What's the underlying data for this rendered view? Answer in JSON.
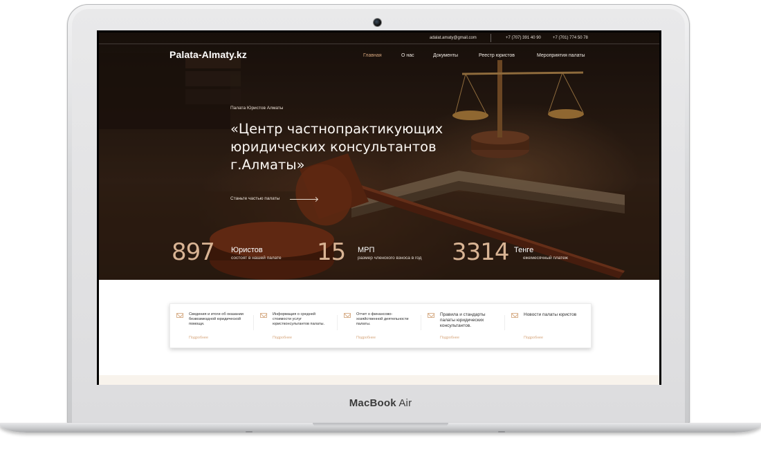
{
  "device": {
    "brand_bold": "MacBook",
    "brand_light": "Air"
  },
  "topbar": {
    "email": "adalat.amaty@gmail.com",
    "phone1": "+7 (707) 391 40 90",
    "phone2": "+7 (701) 774 50 78"
  },
  "header": {
    "logo": "Palata-Almaty.kz",
    "nav": [
      {
        "label": "Главная",
        "active": true
      },
      {
        "label": "О нас",
        "active": false
      },
      {
        "label": "Документы",
        "active": false
      },
      {
        "label": "Реестр юристов",
        "active": false
      },
      {
        "label": "Мероприятия палаты",
        "active": false
      }
    ]
  },
  "hero": {
    "kicker": "Палата Юристов Алматы",
    "headline_1": "«Центр частнопрактикующих",
    "headline_2": "юридических консультантов",
    "headline_3": "г.Алматы»",
    "cta": "Станьте частью палаты"
  },
  "stats": [
    {
      "number": "897",
      "title": "Юристов",
      "subtitle": "состоят в нашей палате"
    },
    {
      "number": "15",
      "title": "МРП",
      "subtitle": "размер членского взноса в год"
    },
    {
      "number": "3314",
      "title": "Тенге",
      "subtitle": "ежемесячный платеж"
    }
  ],
  "cards": [
    {
      "text": "Сведения и итоги об оказании безвозмездной юридической помощи.",
      "more": "Подробнее",
      "icon": "envelope-icon"
    },
    {
      "text": "Информация о средней стоимости услуг юристконсультантов палаты.",
      "more": "Подробнее",
      "icon": "envelope-icon"
    },
    {
      "text": "Отчет о финансово-хозяйственной деятельности палаты.",
      "more": "Подробнее",
      "icon": "envelope-icon"
    },
    {
      "text": "Правила и стандарты палаты юридических консультантов.",
      "more": "Подробнее",
      "icon": "envelope-icon"
    },
    {
      "text": "Новости палаты юристов",
      "more": "Подробнее",
      "icon": "envelope-icon"
    }
  ],
  "colors": {
    "accent": "#d7a77e",
    "stat_number": "#d9b494",
    "hero_dark": "#2b1c13"
  }
}
